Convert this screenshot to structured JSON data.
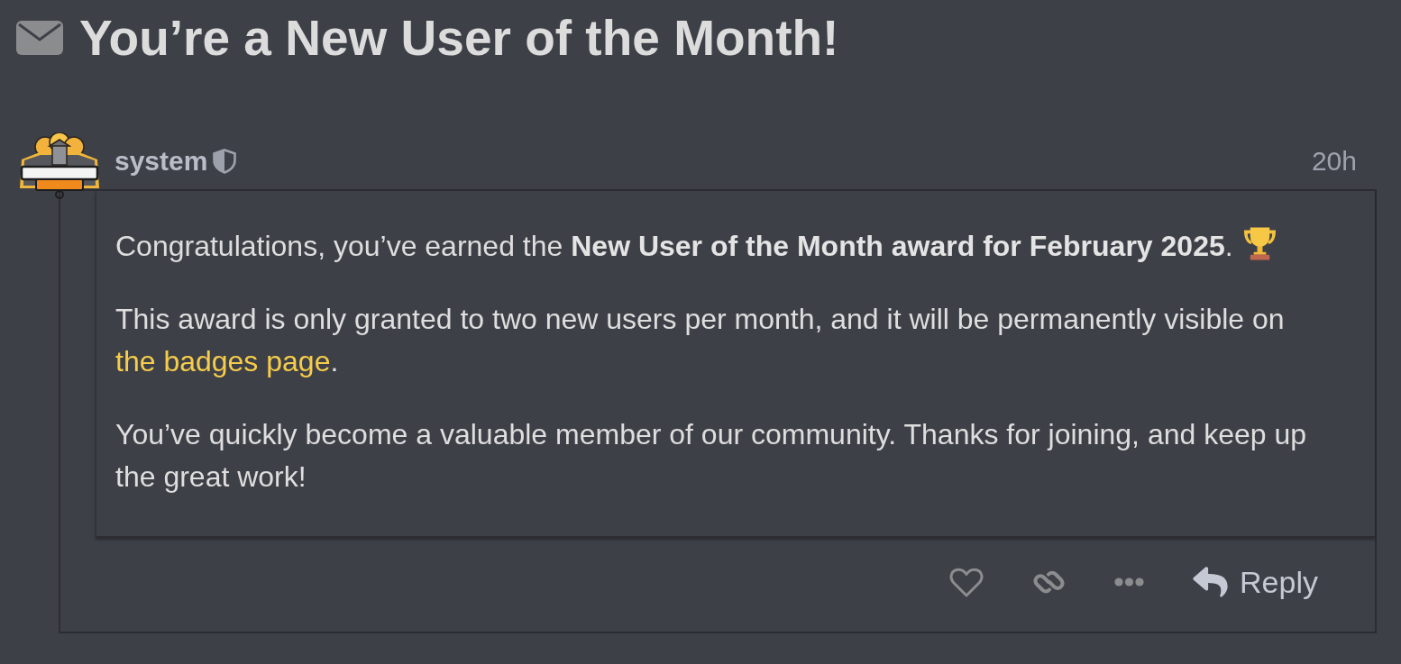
{
  "title": {
    "text": "You’re a New User of the Month!"
  },
  "post": {
    "author": "system",
    "time": "20h",
    "paragraphs": [
      {
        "segments": [
          {
            "kind": "text",
            "text": "Congratulations, you’ve earned the **New User of the Month award for February 2025**."
          },
          {
            "kind": "emoji"
          }
        ]
      },
      {
        "segments": [
          {
            "kind": "text",
            "text": "This award is only granted to two new users per month, and it will be permanently visible on "
          },
          {
            "kind": "link",
            "text": "the badges page"
          },
          {
            "kind": "text",
            "text": "."
          }
        ]
      },
      {
        "segments": [
          {
            "kind": "text",
            "text": "You’ve quickly become a valuable member of our community. Thanks for joining, and keep up the great work!"
          }
        ]
      }
    ],
    "actions": [
      {
        "kind": "like"
      },
      {
        "kind": "copy_link"
      },
      {
        "kind": "more"
      },
      {
        "kind": "reply",
        "label": "Reply"
      }
    ]
  }
}
